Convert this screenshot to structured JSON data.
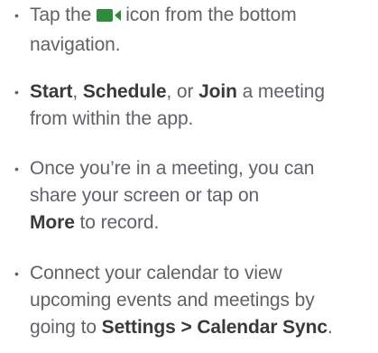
{
  "colors": {
    "text": "#5f6368",
    "bold_text": "#3a3a3a",
    "icon_green": "#2d8c3c"
  },
  "items": [
    {
      "icon": "video-camera-icon",
      "text_a": "Tap the",
      "text_b": "icon from the bottom",
      "text_c": "navigation."
    },
    {
      "b1": "Start",
      "t1": ", ",
      "b2": "Schedule",
      "t2": ", or ",
      "b3": "Join",
      "t3": " a meeting",
      "t4": "from within the app."
    },
    {
      "t1": "Once you’re in a meeting, you can",
      "t2": "share your screen or tap on",
      "b1": "More",
      "t3": " to record."
    },
    {
      "t1": "Connect your calendar to view",
      "t2": "upcoming events and meetings by",
      "t3": "going to ",
      "b1": "Settings > Calendar Sync",
      "t4": "."
    }
  ]
}
